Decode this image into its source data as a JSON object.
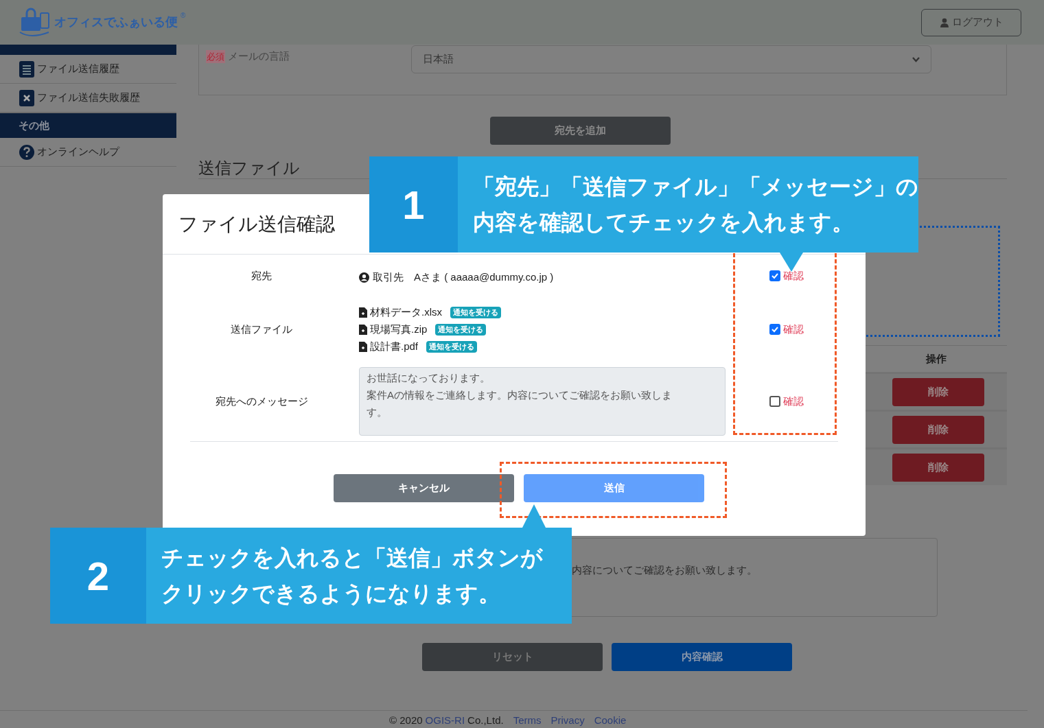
{
  "header": {
    "logo_text": "オフィスでふぁいる便",
    "logo_mark": "®",
    "logout_button": "ログアウト"
  },
  "sidebar": {
    "items": [
      {
        "kind": "item",
        "label": "ファイル送信履歴"
      },
      {
        "kind": "item",
        "label": "ファイル送信失敗履歴"
      },
      {
        "kind": "section",
        "label": "その他"
      },
      {
        "kind": "item",
        "label": "オンラインヘルプ"
      }
    ]
  },
  "form": {
    "required_badge": "必須",
    "language_label": "メールの言語",
    "language_select": "日本語",
    "add_recipient_button": "宛先を追加",
    "section_title": "送信ファイル"
  },
  "table": {
    "columns": [
      "操作"
    ],
    "rows": [
      {
        "action": "削除"
      },
      {
        "action": "削除"
      },
      {
        "action": "削除"
      }
    ]
  },
  "message_field": {
    "value": "内容についてご確認をお願い致します。"
  },
  "form_buttons": [
    "リセット",
    "内容確認"
  ],
  "footer": {
    "copyright": "© 2020",
    "company": "OGIS-RI",
    "suffix": "Co.,Ltd.",
    "links": [
      "Terms",
      "Privacy",
      "Cookie"
    ]
  },
  "dialog": {
    "title": "ファイル送信確認",
    "rows": [
      {
        "kind": "recipient",
        "label": "宛先",
        "recipient": "取引先　Aさま ( aaaaa@dummy.co.jp )",
        "checked": true,
        "confirm_label": "確認"
      },
      {
        "kind": "files",
        "label": "送信ファイル",
        "files": [
          {
            "name": "材料データ.xlsx",
            "badge": "通知を受ける"
          },
          {
            "name": "現場写真.zip",
            "badge": "通知を受ける"
          },
          {
            "name": "設計書.pdf",
            "badge": "通知を受ける"
          }
        ],
        "checked": true,
        "confirm_label": "確認"
      },
      {
        "kind": "message",
        "label": "宛先へのメッセージ",
        "message_lines": [
          "お世話になっております。",
          "案件Aの情報をご連絡します。内容についてご確認をお願い致します。"
        ],
        "checked": false,
        "confirm_label": "確認"
      }
    ],
    "buttons": [
      {
        "kind": "secondary",
        "label": "キャンセル",
        "disabled": false
      },
      {
        "kind": "primary",
        "label": "送信",
        "disabled": true
      }
    ]
  },
  "callouts": [
    {
      "number": "1",
      "lines": [
        "「宛先」「送信ファイル」「メッセージ」の",
        "内容を確認してチェックを入れます。"
      ]
    },
    {
      "number": "2",
      "lines": [
        "チェックを入れると「送信」ボタンが",
        "クリックできるようになります。"
      ]
    }
  ]
}
